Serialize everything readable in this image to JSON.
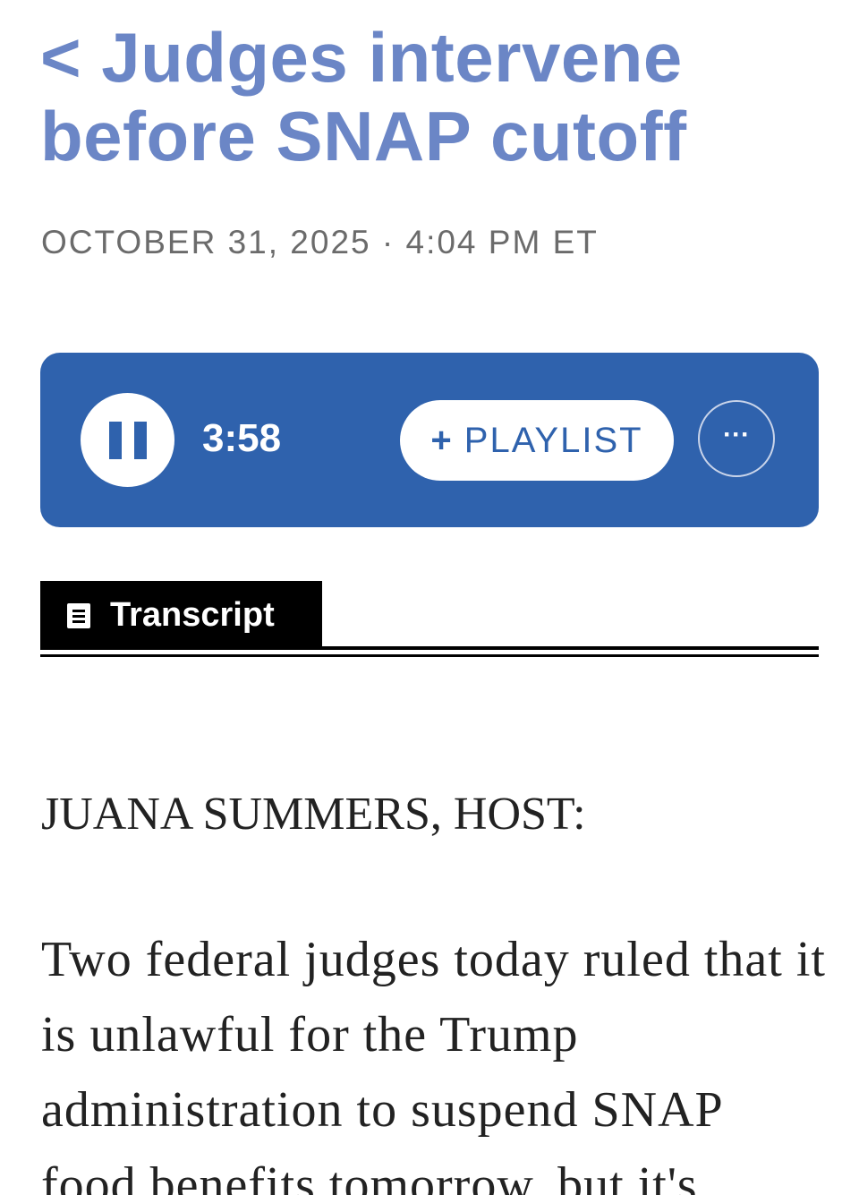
{
  "header": {
    "back_symbol": "<",
    "title": "Judges intervene before SNAP cutoff"
  },
  "meta": {
    "date": "OCTOBER 31, 2025",
    "separator": "·",
    "time": "4:04 PM ET"
  },
  "player": {
    "state": "playing",
    "pause_icon": "pause-icon",
    "duration": "3:58",
    "playlist_plus": "+",
    "playlist_label": "PLAYLIST",
    "more_label": "···",
    "accent_color": "#2f62ad"
  },
  "tabs": {
    "transcript_icon": "document-icon",
    "transcript_label": "Transcript"
  },
  "transcript": {
    "speaker": "JUANA SUMMERS, HOST:",
    "paragraph": "Two federal judges today ruled that it is unlawful for the Trump administration to suspend SNAP food benefits tomorrow, but it's"
  },
  "colors": {
    "headline": "#6b86c6",
    "dateline": "#6b6b6b",
    "body_text": "#222222"
  }
}
